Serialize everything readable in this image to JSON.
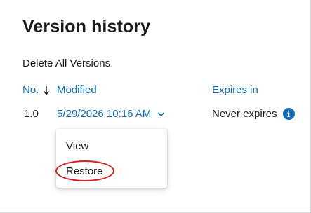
{
  "panel": {
    "title": "Version history",
    "delete_all_label": "Delete All Versions"
  },
  "table": {
    "columns": {
      "no": "No.",
      "modified": "Modified",
      "expires": "Expires in"
    },
    "sort_direction": "descending",
    "rows": [
      {
        "no": "1.0",
        "modified": "5/29/2026 10:16 AM",
        "expires": "Never expires"
      }
    ]
  },
  "context_menu": {
    "items": [
      {
        "label": "View"
      },
      {
        "label": "Restore"
      }
    ],
    "highlighted_item": "Restore"
  },
  "colors": {
    "link": "#0f6cbd",
    "text": "#1b1b1b",
    "highlight_ring": "#d81e1e"
  },
  "icons": {
    "sort": "arrow-down-icon",
    "expand": "chevron-down-icon",
    "info": "info-icon"
  }
}
